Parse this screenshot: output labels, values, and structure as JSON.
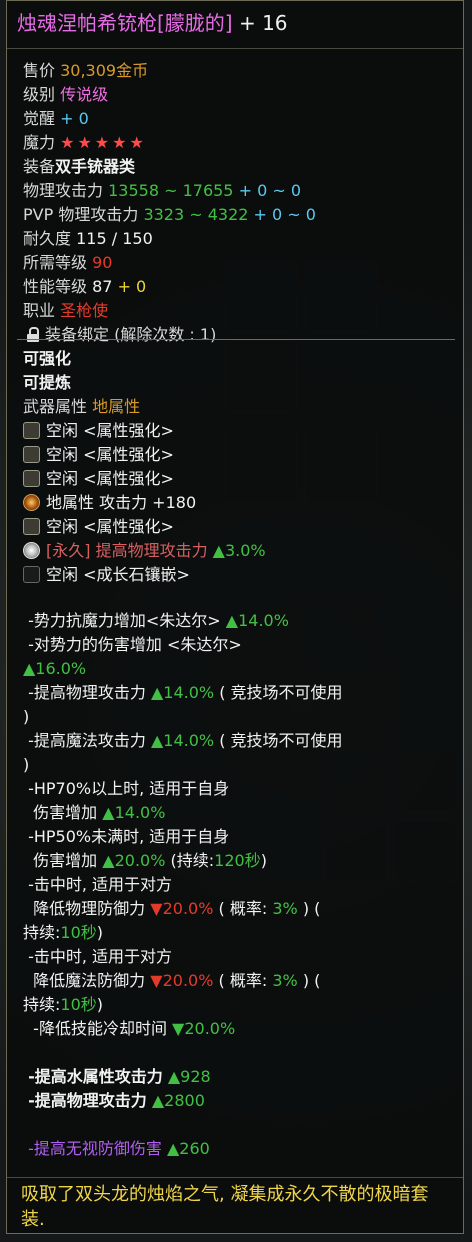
{
  "item": {
    "name": "烛魂涅帕希铳枪[朦胧的]",
    "plus": "+ 16"
  },
  "info": {
    "price_label": "售价",
    "price_value": "30,309金币",
    "grade_label": "级别",
    "grade_value": "传说级",
    "awaken_label": "觉醒",
    "awaken_value": "+ 0",
    "magic_label": "魔力",
    "magic_stars": "★★★★★",
    "equip_label": "装备",
    "equip_value": "双手铳器类",
    "phys_label": "物理攻击力",
    "phys_range": "13558 ~ 17655",
    "phys_bonus": "+ 0 ~ 0",
    "pvp_label": "PVP 物理攻击力",
    "pvp_range": "3323 ~ 4322",
    "pvp_bonus": "+ 0 ~ 0",
    "durability_label": "耐久度",
    "durability_value": "115 / 150",
    "req_level_label": "所需等级",
    "req_level_value": "90",
    "perf_label": "性能等级",
    "perf_value": "87",
    "perf_bonus": "+ 0",
    "class_label": "职业",
    "class_value": "圣枪使",
    "bind_text": "装备绑定 (解除次数 : 1)"
  },
  "enhance": {
    "can_enhance": "可强化",
    "can_refine": "可提炼",
    "attr_label": "武器属性",
    "attr_value": "地属性",
    "slots": [
      "空闲 <属性强化>",
      "空闲 <属性强化>",
      "空闲 <属性强化>",
      "地属性 攻击力 +180",
      "空闲 <属性强化>"
    ],
    "perm_tag": "[永久] 提高物理攻击力",
    "perm_value": "▲3.0%",
    "growth_slot": "空闲 <成长石镶嵌>"
  },
  "effects": {
    "l1_a": "-势力抗魔力增加<朱达尔>",
    "l1_b": "▲14.0%",
    "l2_a": "-对势力的伤害增加 <朱达尔>",
    "l2_b": "▲16.0%",
    "l3_a": "-提高物理攻击力",
    "l3_b": "▲14.0%",
    "l3_c": "( 竞技场不可使用",
    "l3_d": ")",
    "l4_a": "-提高魔法攻击力",
    "l4_b": "▲14.0%",
    "l4_c": "( 竞技场不可使用",
    "l4_d": ")",
    "l5_a": "-HP70%以上时, 适用于自身",
    "l5_b": "伤害增加",
    "l5_c": "▲14.0%",
    "l6_a": "-HP50%未满时, 适用于自身",
    "l6_b": "伤害增加",
    "l6_c": "▲20.0%",
    "l6_d": "(持续:",
    "l6_e": "120秒",
    "l6_f": ")",
    "l7_a": "-击中时, 适用于对方",
    "l7_b": "降低物理防御力",
    "l7_c": "▼20.0%",
    "l7_d": "( 概率:",
    "l7_e": "3%",
    "l7_f": ") (",
    "l7_g": "持续:",
    "l7_h": "10秒",
    "l7_i": ")",
    "l8_a": "-击中时, 适用于对方",
    "l8_b": "降低魔法防御力",
    "l8_c": "▼20.0%",
    "l8_d": "( 概率:",
    "l8_e": "3%",
    "l8_f": ") (",
    "l8_g": "持续:",
    "l8_h": "10秒",
    "l8_i": ")",
    "l9_a": "-降低技能冷却时间",
    "l9_b": "▼20.0%",
    "l10_a": "-提高水属性攻击力",
    "l10_b": "▲928",
    "l11_a": "-提高物理攻击力",
    "l11_b": "▲2800",
    "l12_a": "-提高无视防御伤害",
    "l12_b": "▲260"
  },
  "description": "吸取了双头龙的烛焰之气, 凝集成永久不散的极暗套装.",
  "colors": {
    "name": "#e66be6",
    "green": "#42c044",
    "red": "#e33b2b",
    "orange": "#d89a2a",
    "description": "#efd64a"
  }
}
